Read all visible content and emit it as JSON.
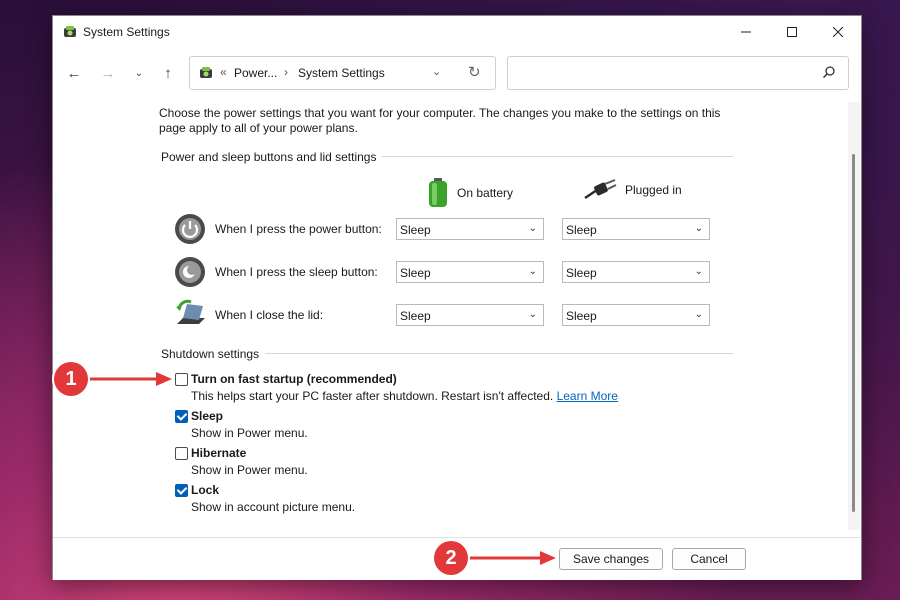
{
  "window": {
    "title": "System Settings"
  },
  "address": {
    "crumbs": [
      "Power...",
      "System Settings"
    ],
    "search_placeholder": ""
  },
  "intro": "Choose the power settings that you want for your computer. The changes you make to the settings on this page apply to all of your power plans.",
  "buttons_section": {
    "title": "Power and sleep buttons and lid settings",
    "col_battery": "On battery",
    "col_plugged": "Plugged in",
    "rows": [
      {
        "label": "When I press the power button:",
        "battery": "Sleep",
        "plugged": "Sleep",
        "icon": "power-button-icon"
      },
      {
        "label": "When I press the sleep button:",
        "battery": "Sleep",
        "plugged": "Sleep",
        "icon": "sleep-button-icon"
      },
      {
        "label": "When I close the lid:",
        "battery": "Sleep",
        "plugged": "Sleep",
        "icon": "laptop-lid-icon"
      }
    ]
  },
  "shutdown": {
    "title": "Shutdown settings",
    "options": [
      {
        "title": "Turn on fast startup (recommended)",
        "desc": "This helps start your PC faster after shutdown. Restart isn't affected.",
        "link": "Learn More",
        "checked": false
      },
      {
        "title": "Sleep",
        "desc": "Show in Power menu.",
        "checked": true
      },
      {
        "title": "Hibernate",
        "desc": "Show in Power menu.",
        "checked": false
      },
      {
        "title": "Lock",
        "desc": "Show in account picture menu.",
        "checked": true
      }
    ]
  },
  "footer": {
    "save": "Save changes",
    "cancel": "Cancel"
  },
  "annotations": {
    "one": "1",
    "two": "2"
  },
  "colors": {
    "accent": "#005fb8",
    "annotation": "#e2383a",
    "link": "#0067c0"
  }
}
